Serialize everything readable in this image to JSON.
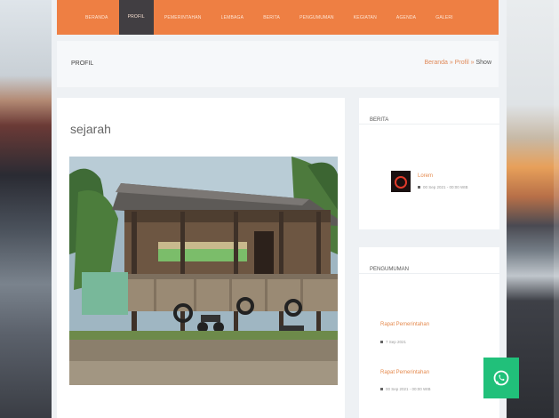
{
  "nav": {
    "items": [
      "BERANDA",
      "PROFIL",
      "PEMERINTAHAN",
      "LEMBAGA",
      "BERITA",
      "PENGUMUMAN",
      "KEGIATAN",
      "AGENDA",
      "GALERI"
    ],
    "active_index": 1
  },
  "page_header": {
    "title": "PROFIL",
    "breadcrumb": [
      "Beranda",
      "Profil",
      "Show"
    ],
    "separator": "»"
  },
  "article": {
    "title": "sejarah",
    "photo_alt": "",
    "excerpt": ""
  },
  "sidebar": {
    "news": {
      "heading": "BERITA",
      "items": [
        {
          "title": "Lorem",
          "date": "00 Sep 2021 - 00:00 WIB"
        }
      ]
    },
    "announcements": {
      "heading": "PENGUMUMAN",
      "items": [
        {
          "title": "Rapat Pemerintahan",
          "date": "7 Sep 2021"
        },
        {
          "title": "Rapat Pemerintahan",
          "date": "00 Sep 2021 - 00:00 WIB"
        }
      ]
    }
  },
  "colors": {
    "accent": "#ee7f43",
    "nav_active": "#2f3742",
    "whatsapp": "#21c07a"
  },
  "icons": {
    "whatsapp": "whatsapp-icon"
  }
}
